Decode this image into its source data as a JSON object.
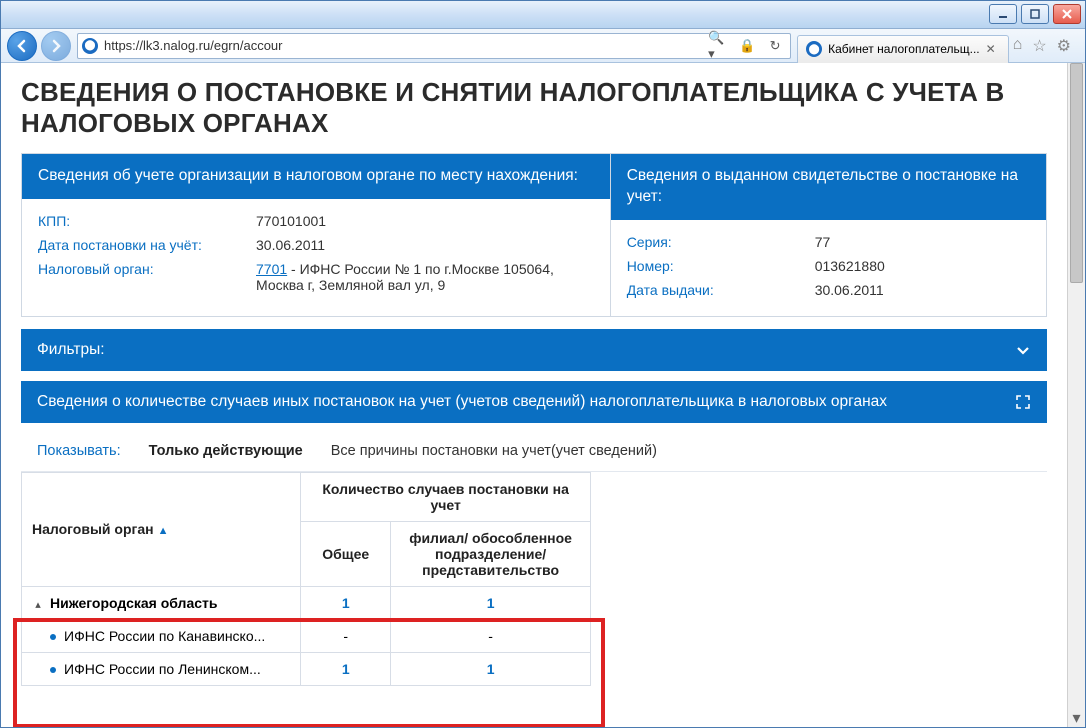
{
  "address_bar": {
    "url": "https://lk3.nalog.ru/egrn/accour"
  },
  "tab": {
    "title": "Кабинет налогоплательщ..."
  },
  "page_title": "СВЕДЕНИЯ О ПОСТАНОВКЕ И СНЯТИИ НАЛОГОПЛАТЕЛЬЩИКА С УЧЕТА В НАЛОГОВЫХ ОРГАНАХ",
  "panel_left": {
    "head": "Сведения об учете организации в налоговом органе по месту нахождения:",
    "rows": {
      "kpp_label": "КПП:",
      "kpp_value": "770101001",
      "date_label": "Дата постановки на учёт:",
      "date_value": "30.06.2011",
      "organ_label": "Налоговый орган:",
      "organ_link": "7701",
      "organ_value_rest": " - ИФНС России № 1 по г.Москве 105064, Москва г, Земляной вал ул, 9"
    }
  },
  "panel_right": {
    "head": "Сведения о выданном свидетельстве о постановке на учет:",
    "rows": {
      "series_label": "Серия:",
      "series_value": "77",
      "number_label": "Номер:",
      "number_value": "013621880",
      "issue_label": "Дата выдачи:",
      "issue_value": "30.06.2011"
    }
  },
  "filters_bar": "Фильтры:",
  "count_bar": "Сведения о количестве случаев иных постановок на учет (учетов сведений) налогоплательщика в налоговых органах",
  "filter_row": {
    "label": "Показывать:",
    "active": "Только действующие",
    "other": "Все причины постановки на учет(учет сведений)"
  },
  "table": {
    "head": {
      "organ": "Налоговый орган",
      "count_group": "Количество случаев постановки на учет",
      "total": "Общее",
      "filial": "филиал/ обособленное подразделение/ представительство"
    },
    "rows": [
      {
        "name": "Нижегородская область",
        "total": "1",
        "filial": "1",
        "type": "group"
      },
      {
        "name": "ИФНС России по Канавинско...",
        "total": "-",
        "filial": "-",
        "type": "child"
      },
      {
        "name": "ИФНС России по Ленинском...",
        "total": "1",
        "filial": "1",
        "type": "child"
      }
    ]
  }
}
